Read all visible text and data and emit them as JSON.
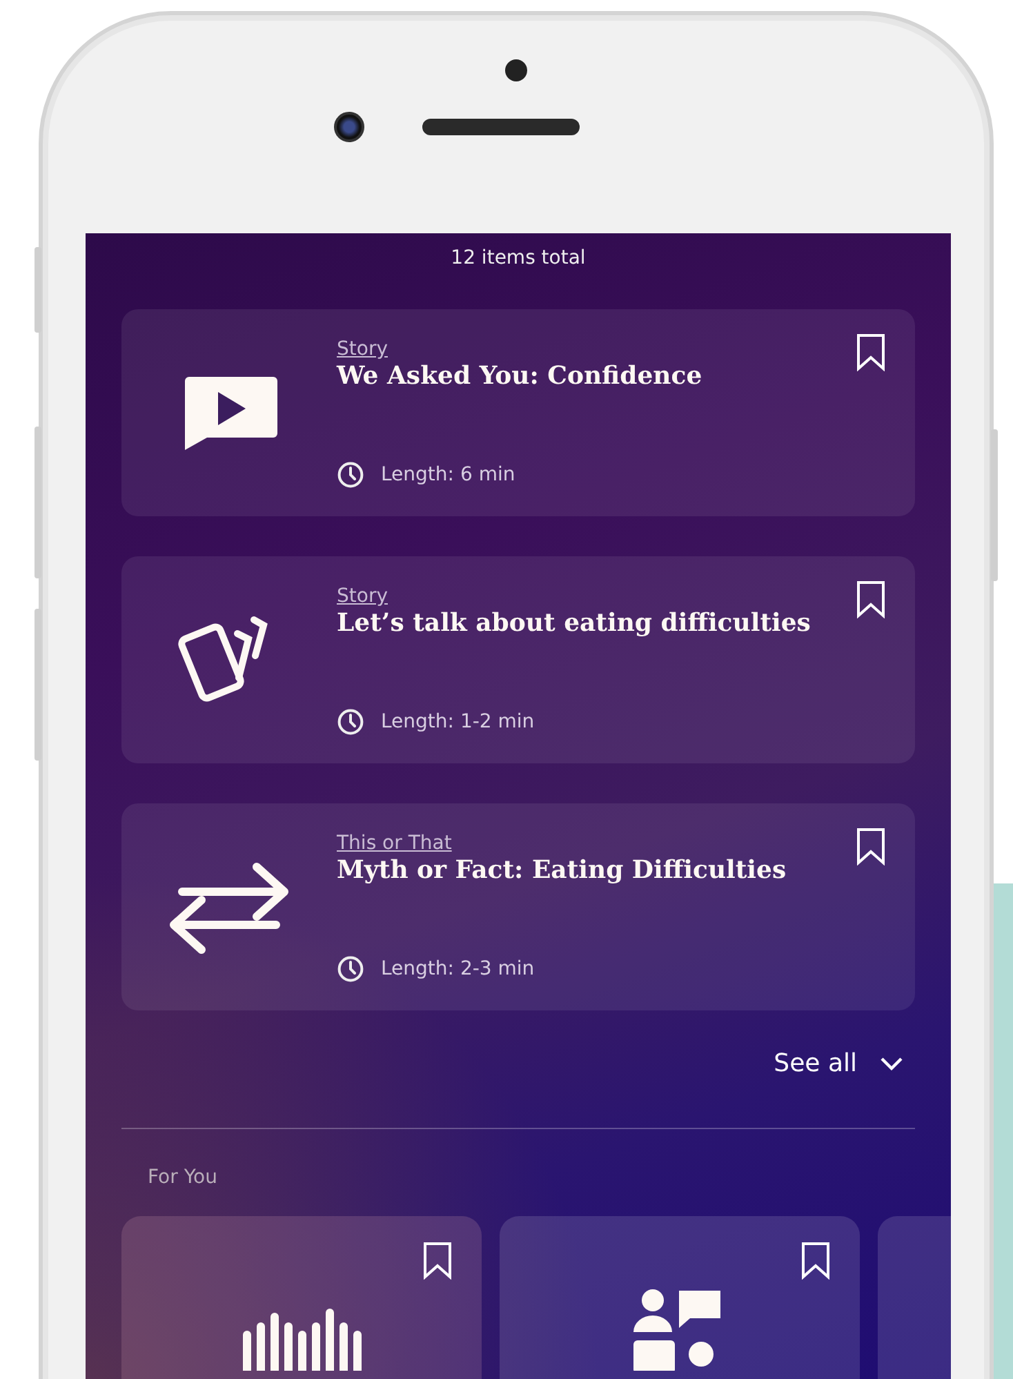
{
  "list_header": {
    "count": "12 items total"
  },
  "items": [
    {
      "kind": "video",
      "category": "Story",
      "title": "We Asked You: Confidence",
      "length": "Length: 6 min"
    },
    {
      "kind": "cards",
      "category": "Story",
      "title": "Let’s talk about eating difficulties",
      "length": "Length: 1-2 min"
    },
    {
      "kind": "swap",
      "category": "This or That",
      "title": "Myth or Fact: Eating Difficulties",
      "length": "Length: 2-3 min"
    }
  ],
  "see_all": "See all",
  "for_you": {
    "heading": "For You",
    "items": [
      {
        "kind": "audio"
      },
      {
        "kind": "chat"
      },
      {
        "kind": "partial"
      }
    ]
  }
}
